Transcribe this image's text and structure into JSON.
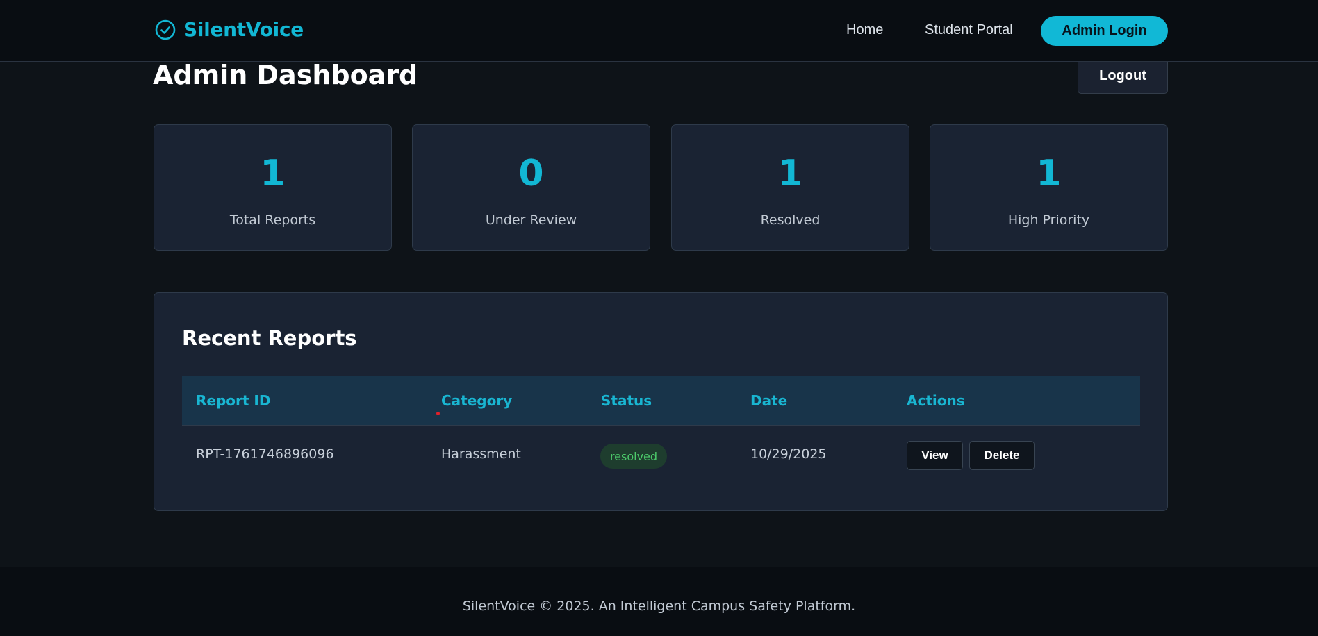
{
  "nav": {
    "brand": "SilentVoice",
    "links": [
      "Home",
      "Student Portal"
    ],
    "admin_login": "Admin Login",
    "brand_color": "#12b7d4"
  },
  "header": {
    "title": "Admin Dashboard",
    "logout": "Logout"
  },
  "stats": [
    {
      "value": "1",
      "label": "Total Reports"
    },
    {
      "value": "0",
      "label": "Under Review"
    },
    {
      "value": "1",
      "label": "Resolved"
    },
    {
      "value": "1",
      "label": "High Priority"
    }
  ],
  "reports": {
    "title": "Recent Reports",
    "columns": [
      "Report ID",
      "Category",
      "Status",
      "Date",
      "Actions"
    ],
    "rows": [
      {
        "id": "RPT-1761746896096",
        "category": "Harassment",
        "status": "resolved",
        "date": "10/29/2025",
        "actions": [
          "View",
          "Delete"
        ]
      }
    ]
  },
  "footer": {
    "text": "SilentVoice © 2025. An Intelligent Campus Safety Platform."
  },
  "icons": {
    "brand_icon": "check-circle-icon"
  },
  "colors": {
    "accent": "#12b7d4",
    "status_resolved": "#4cc96a",
    "background": "#0e1318",
    "card": "#1a2333"
  }
}
